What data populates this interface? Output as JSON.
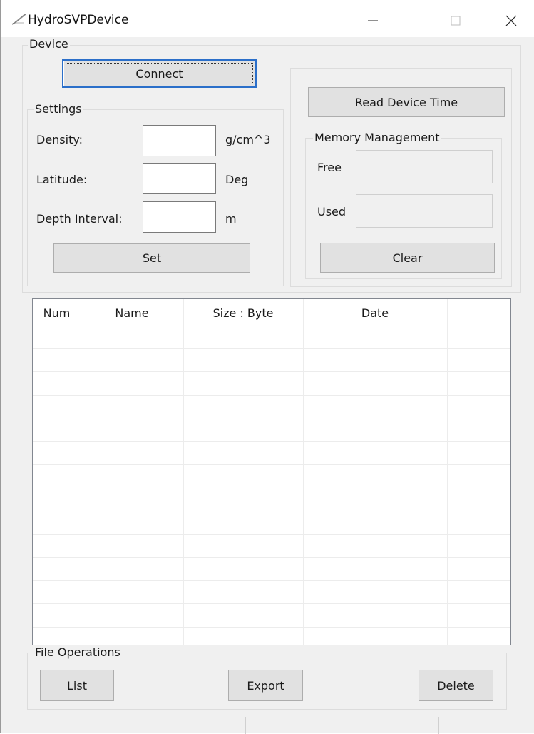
{
  "window": {
    "title": "HydroSVPDevice",
    "icon": "feather-pen-icon"
  },
  "device_group": {
    "label": "Device",
    "connect_label": "Connect"
  },
  "settings": {
    "label": "Settings",
    "density_label": "Density:",
    "density_unit": "g/cm^3",
    "density_value": "",
    "latitude_label": "Latitude:",
    "latitude_unit": "Deg",
    "latitude_value": "",
    "depth_interval_label": "Depth Interval:",
    "depth_interval_unit": "m",
    "depth_interval_value": "",
    "set_label": "Set"
  },
  "device_time": {
    "read_label": "Read  Device Time"
  },
  "memory": {
    "label": "Memory Management",
    "free_label": "Free",
    "used_label": "Used",
    "clear_label": "Clear"
  },
  "file_list": {
    "columns": [
      "Num",
      "Name",
      "Size : Byte",
      "Date"
    ],
    "rows": []
  },
  "file_operations": {
    "label": "File Operations",
    "list_label": "List",
    "export_label": "Export",
    "delete_label": "Delete"
  }
}
